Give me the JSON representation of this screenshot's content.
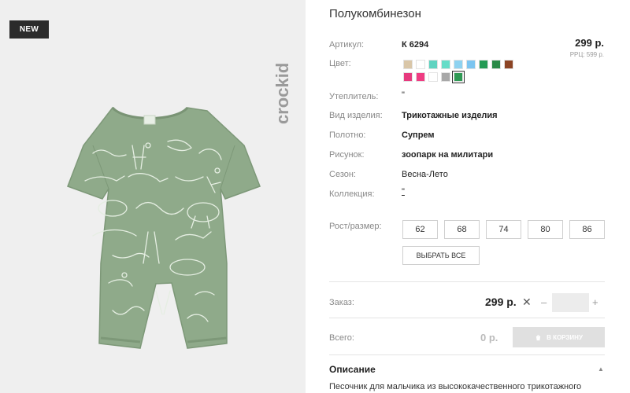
{
  "badge": "NEW",
  "brand": "crockid",
  "product": {
    "title": "Полукомбинезон",
    "price": "299 р.",
    "rrp": "РРЦ: 599 р."
  },
  "specs": {
    "article_label": "Артикул:",
    "article_value": "К 6294",
    "color_label": "Цвет:",
    "insulation_label": "Утеплитель:",
    "insulation_value": "\"",
    "type_label": "Вид изделия:",
    "type_value": "Трикотажные изделия",
    "fabric_label": "Полотно:",
    "fabric_value": "Супрем",
    "print_label": "Рисунок:",
    "print_value": "зоопарк на милитари",
    "season_label": "Сезон:",
    "season_value": "Весна-Лето",
    "collection_label": "Коллекция:",
    "collection_value": "\""
  },
  "colors": {
    "row1": [
      "#d9c6a8",
      "#ffffff",
      "#5fd3c0",
      "#66ddc8",
      "#8ed2f0",
      "#7cc5f0",
      "#249a55",
      "#2a8a48",
      "#8c4424"
    ],
    "row2": [
      "#e63a7e",
      "#ef3c82",
      "#ffffff",
      "#a8a8a8",
      "#2f9a55"
    ],
    "selected_index_row2": 4
  },
  "sizes": {
    "label": "Рост/размер:",
    "items": [
      "62",
      "68",
      "74",
      "80",
      "86"
    ],
    "select_all": "ВЫБРАТЬ ВСЕ"
  },
  "order": {
    "label": "Заказ:",
    "price": "299 р.",
    "times": "✕",
    "minus": "–",
    "plus": "+",
    "qty": ""
  },
  "total": {
    "label": "Всего:",
    "value": "0 р.",
    "cart_button": "В КОРЗИНУ"
  },
  "description": {
    "title": "Описание",
    "text": "Песочник для мальчика из высококачественного трикотажного"
  }
}
